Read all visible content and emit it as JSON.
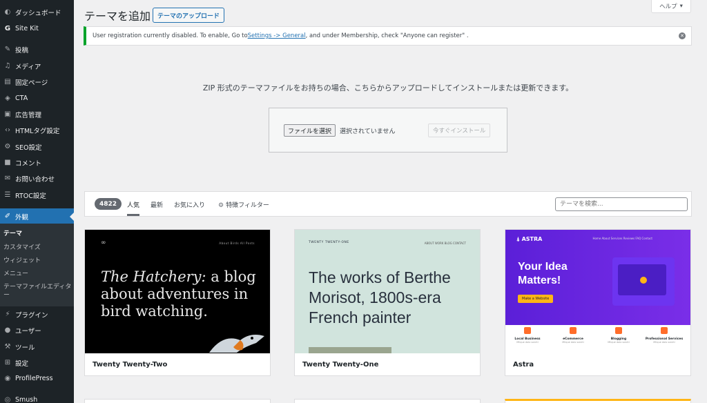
{
  "sidebar": {
    "items": [
      {
        "label": "ダッシュボード",
        "icon": "dashboard-icon"
      },
      {
        "label": "Site Kit",
        "icon": "sitekit-icon"
      },
      {
        "label": "投稿",
        "icon": "pin-icon"
      },
      {
        "label": "メディア",
        "icon": "media-icon"
      },
      {
        "label": "固定ページ",
        "icon": "page-icon"
      },
      {
        "label": "CTA",
        "icon": "tag-icon"
      },
      {
        "label": "広告管理",
        "icon": "ad-icon"
      },
      {
        "label": "HTMLタグ設定",
        "icon": "code-icon"
      },
      {
        "label": "SEO設定",
        "icon": "seo-icon"
      },
      {
        "label": "コメント",
        "icon": "comment-icon"
      },
      {
        "label": "お問い合わせ",
        "icon": "mail-icon"
      },
      {
        "label": "RTOC設定",
        "icon": "list-icon"
      },
      {
        "label": "外観",
        "icon": "brush-icon"
      },
      {
        "label": "プラグイン",
        "icon": "plugin-icon"
      },
      {
        "label": "ユーザー",
        "icon": "user-icon"
      },
      {
        "label": "ツール",
        "icon": "wrench-icon"
      },
      {
        "label": "設定",
        "icon": "settings-icon"
      },
      {
        "label": "ProfilePress",
        "icon": "profilepress-icon"
      },
      {
        "label": "Smush",
        "icon": "smush-icon"
      }
    ],
    "submenu": [
      "テーマ",
      "カスタマイズ",
      "ウィジェット",
      "メニュー",
      "テーマファイルエディター"
    ]
  },
  "header": {
    "title": "テーマを追加",
    "upload_button": "テーマのアップロード",
    "help_button": "ヘルプ"
  },
  "notice": {
    "text_before": "User registration currently disabled. To enable, Go to ",
    "link": "Settings -> General",
    "text_after": ", and under Membership, check \"Anyone can register\" ."
  },
  "upload": {
    "description": "ZIP 形式のテーマファイルをお持ちの場合、こちらからアップロードしてインストールまたは更新できます。",
    "file_button": "ファイルを選択",
    "file_status": "選択されていません",
    "install_button": "今すぐインストール"
  },
  "filter": {
    "count": "4822",
    "tabs": [
      "人気",
      "最新",
      "お気に入り"
    ],
    "feature_filter": "特徴フィルター",
    "search_placeholder": "テーマを検索..."
  },
  "themes": [
    {
      "name": "Twenty Twenty-Two",
      "preview_italic": "The Hatchery:",
      "preview_text": " a blog about adventures in bird watching.",
      "nav": "About   Birds   All Posts"
    },
    {
      "name": "Twenty Twenty-One",
      "preview_brand": "TWENTY TWENTY-ONE",
      "preview_text": "The works of Berthe Morisot, 1800s-era French painter",
      "nav": "ABOUT   WORK   BLOG   CONTACT"
    },
    {
      "name": "Astra",
      "preview_logo": "ASTRA",
      "preview_text": "Your Idea Matters!",
      "preview_cta": "Make a Website",
      "nav": "Home   About   Services   Reviews   FAQ   Contact",
      "features": [
        "Local Business",
        "eCommerce",
        "Blogging",
        "Professional Services"
      ],
      "feature_desc": "Mllque dolo soiciti"
    }
  ]
}
